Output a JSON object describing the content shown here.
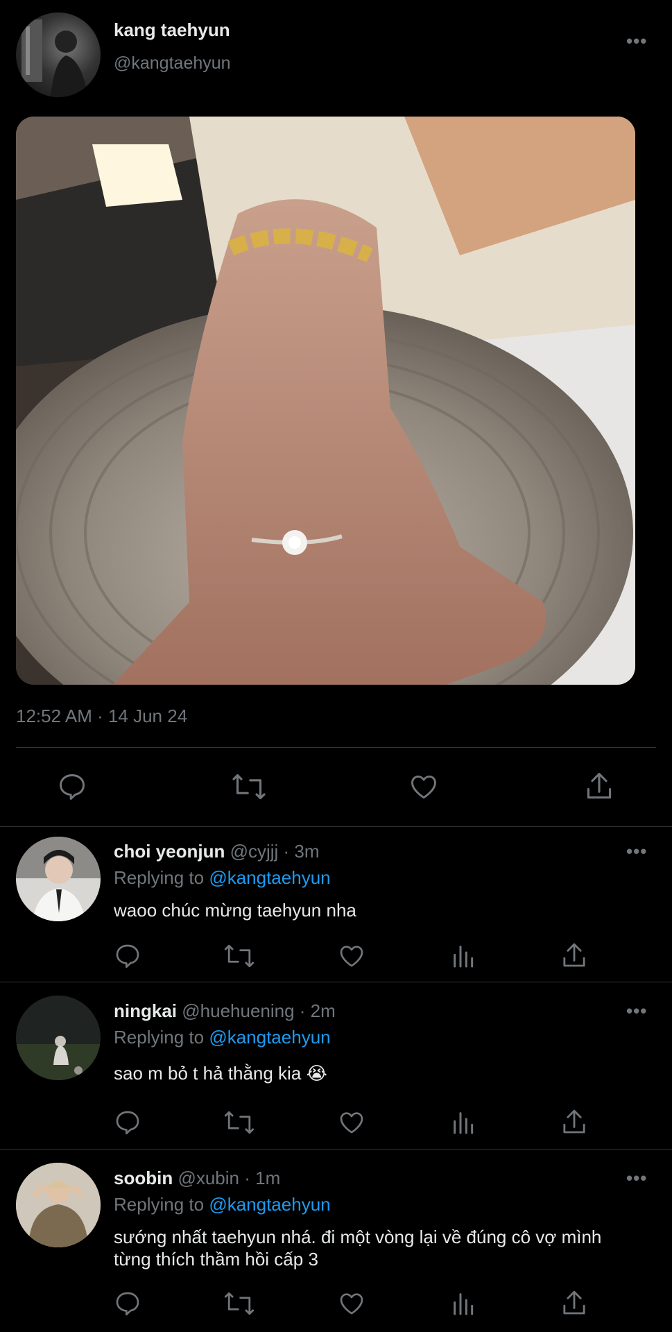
{
  "main_tweet": {
    "display_name": "kang taehyun",
    "handle": "@kangtaehyun",
    "timestamp": "12:52 AM · 14 Jun 24",
    "image_alt_icon": "photo-hand-ring"
  },
  "replies": [
    {
      "display_name": "choi yeonjun",
      "handle": "@cyjjj",
      "time": "· 3m",
      "replying_prefix": "Replying to",
      "replying_to": "@kangtaehyun",
      "text": "waoo chúc mừng taehyun nha"
    },
    {
      "display_name": "ningkai",
      "handle": "@huehuening",
      "time": "· 2m",
      "replying_prefix": "Replying to",
      "replying_to": "@kangtaehyun",
      "text": "sao m bỏ t hả thằng kia 😭"
    },
    {
      "display_name": "soobin",
      "handle": "@xubin",
      "time": "· 1m",
      "replying_prefix": "Replying to",
      "replying_to": "@kangtaehyun",
      "text_line1": "sướng nhất taehyun nhá. đi một vòng lại về đúng cô vợ mình",
      "text_line2": "từng thích thầm hồi cấp 3"
    }
  ],
  "more_glyph": "•••",
  "colors": {
    "background": "#000000",
    "text": "#e7e9ea",
    "muted": "#71767b",
    "link": "#1d9bf0",
    "divider": "#2f3336"
  }
}
